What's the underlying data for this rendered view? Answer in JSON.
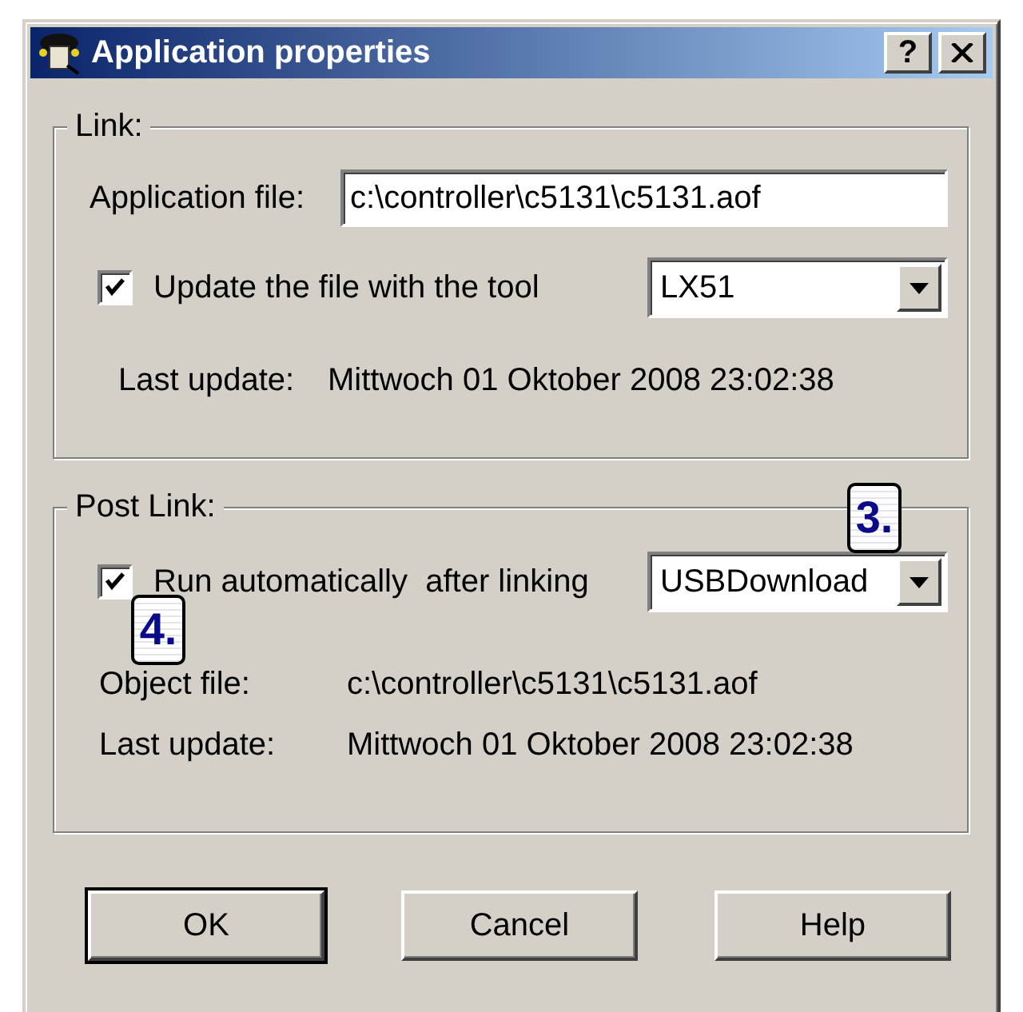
{
  "window": {
    "title": "Application properties",
    "help_button": "?"
  },
  "link": {
    "title": "Link:",
    "application_file": {
      "label": "Application file:",
      "value": "c:\\controller\\c5131\\c5131.aof"
    },
    "update": {
      "label": "Update the file with the tool",
      "checked": true
    },
    "tool": {
      "value": "LX51"
    },
    "last_update": {
      "label": "Last update:",
      "value": "Mittwoch 01 Oktober 2008 23:02:38"
    }
  },
  "post_link": {
    "title": "Post Link:",
    "run": {
      "label": "Run automatically  after linking",
      "checked": true
    },
    "downloader": {
      "value": "USBDownload"
    },
    "object_file": {
      "label": "Object file:",
      "value": "c:\\controller\\c5131\\c5131.aof"
    },
    "last_update": {
      "label": "Last update:",
      "value": "Mittwoch 01 Oktober 2008 23:02:38"
    }
  },
  "buttons": [
    {
      "label": "OK",
      "default": true
    },
    {
      "label": "Cancel",
      "default": false
    },
    {
      "label": "Help",
      "default": false
    }
  ],
  "callouts": [
    {
      "label": "3."
    },
    {
      "label": "4."
    }
  ]
}
